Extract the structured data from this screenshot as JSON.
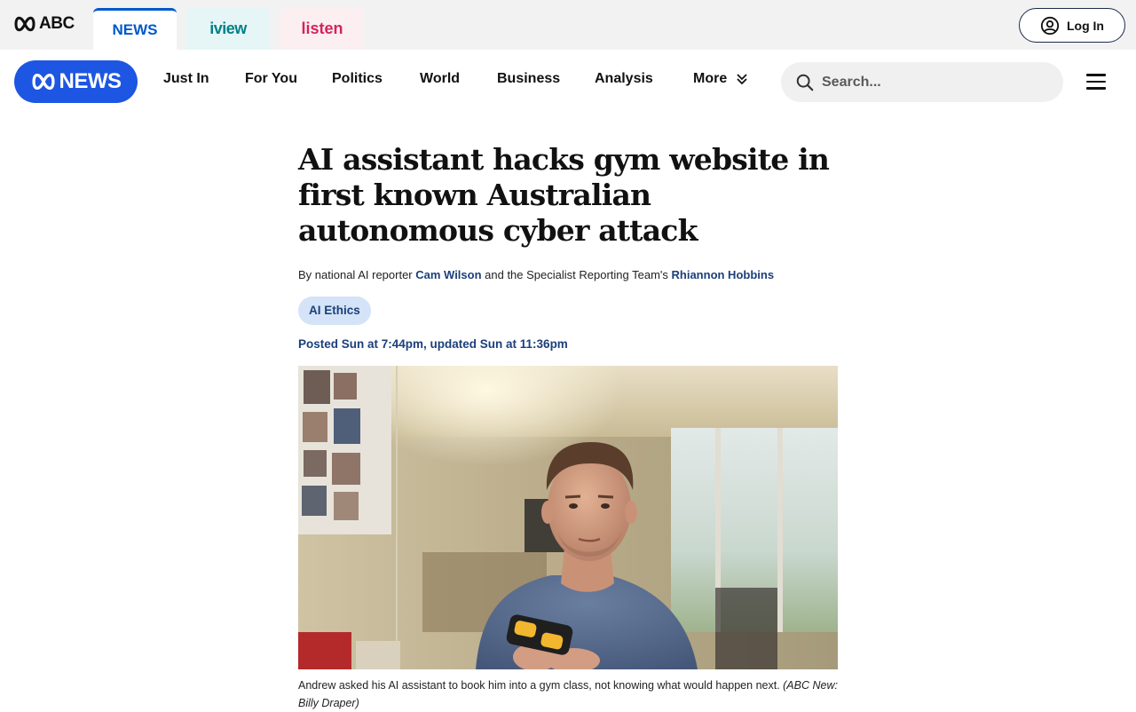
{
  "network": {
    "brand": "ABC",
    "tabs": [
      {
        "label": "NEWS"
      },
      {
        "label": "iview"
      },
      {
        "label": "listen"
      }
    ],
    "login_label": "Log In"
  },
  "nav": {
    "logo_text": "NEWS",
    "items": [
      "Just In",
      "For You",
      "Politics",
      "World",
      "Business",
      "Analysis"
    ],
    "more_label": "More",
    "search_placeholder": "Search..."
  },
  "article": {
    "headline": "AI assistant hacks gym website in first known Australian autonomous cyber attack",
    "byline_prefix": "By national AI reporter ",
    "author1": "Cam Wilson",
    "byline_mid": " and the Specialist Reporting Team's ",
    "author2": "Rhiannon Hobbins",
    "tag": "AI Ethics",
    "timestamp": "Posted Sun at 7:44pm, updated Sun at 11:36pm",
    "caption": "Andrew asked his AI assistant to book him into a gym class, not knowing what would happen next. ",
    "caption_credit": "(ABC New: Billy Draper)"
  },
  "colors": {
    "news_blue": "#1d56e2",
    "link_navy": "#1b3f7a",
    "tag_bg": "#d4e3f7",
    "iview_teal": "#00808a",
    "listen_pink": "#d4245c"
  }
}
